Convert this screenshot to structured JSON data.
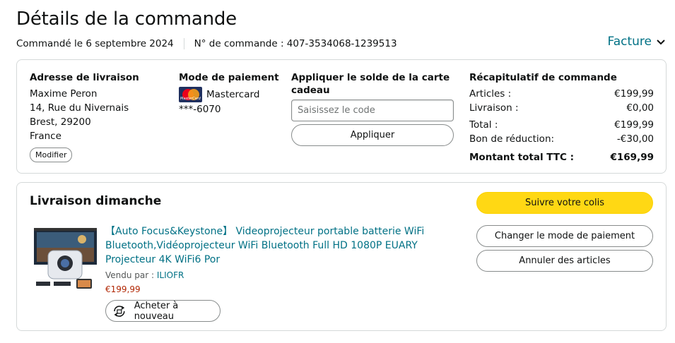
{
  "page": {
    "title": "Détails de la commande",
    "order_date": "Commandé le 6 septembre 2024",
    "order_number": "N° de commande : 407-3534068-1239513",
    "invoice_label": "Facture"
  },
  "shipping": {
    "heading": "Adresse de livraison",
    "name": "Maxime Peron",
    "street": "14, Rue du Nivernais",
    "city": "Brest, 29200",
    "country": "France",
    "edit_label": "Modifier"
  },
  "payment": {
    "heading": "Mode de paiement",
    "card_name": "Mastercard",
    "card_logo_text": "MasterCard",
    "card_number": "***-6070"
  },
  "gift": {
    "heading": "Appliquer le solde de la carte cadeau",
    "placeholder": "Saisissez le code",
    "apply_label": "Appliquer"
  },
  "summary": {
    "heading": "Récapitulatif de commande",
    "rows": [
      {
        "label": "Articles :",
        "value": "€199,99"
      },
      {
        "label": "Livraison :",
        "value": "€0,00"
      },
      {
        "label": "Total :",
        "value": "€199,99"
      },
      {
        "label": "Bon de réduction:",
        "value": "-€30,00"
      }
    ],
    "total_label": "Montant total TTC :",
    "total_value": "€169,99"
  },
  "delivery": {
    "title": "Livraison dimanche",
    "product_title": "【Auto Focus&Keystone】 Videoprojecteur portable batterie WiFi Bluetooth,Vidéoprojecteur WiFi Bluetooth Full HD 1080P EUARY Projecteur 4K WiFi6 Por",
    "sold_by_prefix": "Vendu par : ",
    "seller": "ILIOFR",
    "price": "€199,99",
    "rebuy_label": "Acheter à nouveau",
    "track_label": "Suivre votre colis",
    "change_payment_label": "Changer le mode de paiement",
    "cancel_label": "Annuler des articles"
  },
  "colors": {
    "link": "#007185",
    "price": "#b12704",
    "primary_button": "#ffd814",
    "border": "#d5d9d9"
  }
}
